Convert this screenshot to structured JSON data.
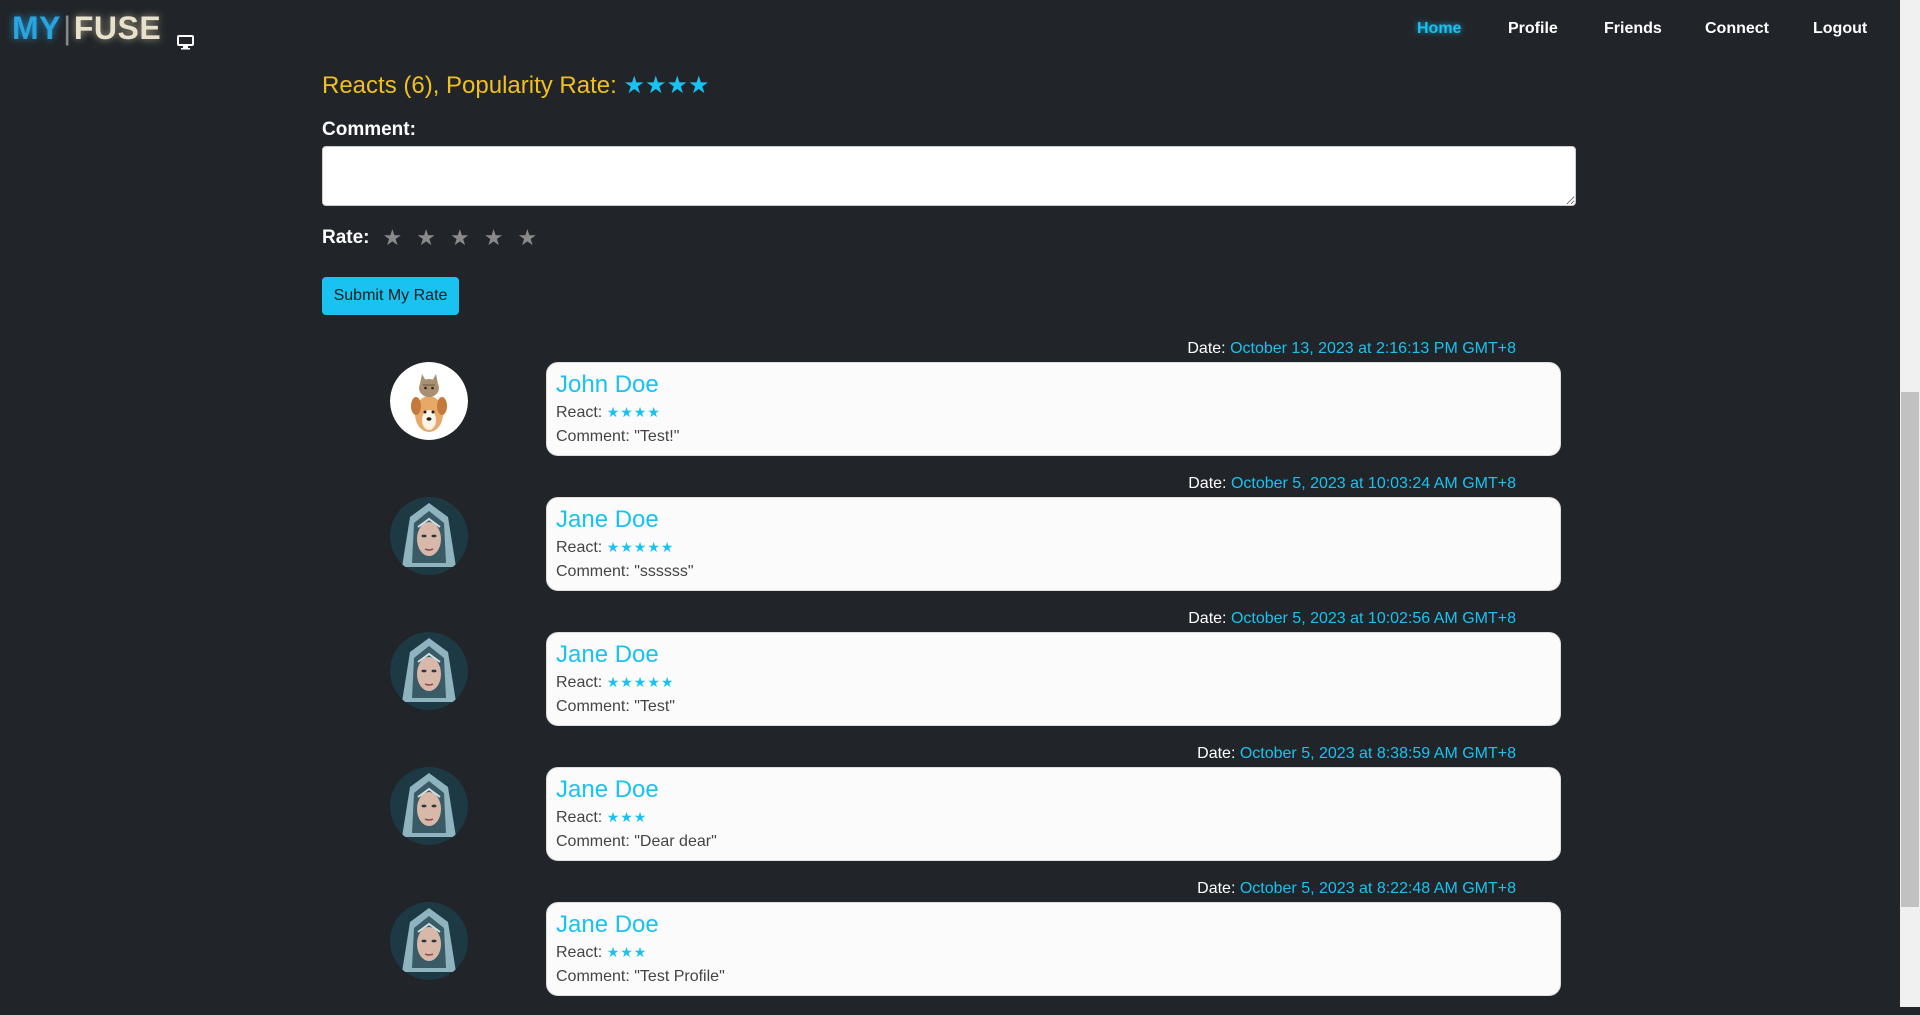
{
  "brand": {
    "my": "MY",
    "sep": "|",
    "fuse": "FUSE",
    "icon": "monitor-icon"
  },
  "nav": [
    {
      "label": "Home",
      "active": true
    },
    {
      "label": "Profile",
      "active": false
    },
    {
      "label": "Friends",
      "active": false
    },
    {
      "label": "Connect",
      "active": false
    },
    {
      "label": "Logout",
      "active": false
    }
  ],
  "summary": {
    "text": "Reacts (6),  Popularity Rate:",
    "stars": "★★★★"
  },
  "comment": {
    "label": "Comment:",
    "value": "",
    "placeholder": ""
  },
  "rate": {
    "label": "Rate:",
    "stars": [
      "★",
      "★",
      "★",
      "★",
      "★"
    ],
    "selected": 0
  },
  "submit_label": "Submit My Rate",
  "reviews": [
    {
      "date_label": "Date:",
      "date": "October 13, 2023 at 2:16:13 PM GMT+8",
      "name": "John Doe",
      "react_label": "React:",
      "stars": "★★★★",
      "comment": "Comment: \"Test!\"",
      "avatar": "dog-cat-avatar"
    },
    {
      "date_label": "Date:",
      "date": "October 5, 2023 at 10:03:24 AM GMT+8",
      "name": "Jane Doe",
      "react_label": "React:",
      "stars": "★★★★★",
      "comment": "Comment: \"ssssss\"",
      "avatar": "warrior-woman-avatar"
    },
    {
      "date_label": "Date:",
      "date": "October 5, 2023 at 10:02:56 AM GMT+8",
      "name": "Jane Doe",
      "react_label": "React:",
      "stars": "★★★★★",
      "comment": "Comment: \"Test\"",
      "avatar": "warrior-woman-avatar"
    },
    {
      "date_label": "Date:",
      "date": "October 5, 2023 at 8:38:59 AM GMT+8",
      "name": "Jane Doe",
      "react_label": "React:",
      "stars": "★★★",
      "comment": "Comment: \"Dear dear\"",
      "avatar": "warrior-woman-avatar"
    },
    {
      "date_label": "Date:",
      "date": "October 5, 2023 at 8:22:48 AM GMT+8",
      "name": "Jane Doe",
      "react_label": "React:",
      "stars": "★★★",
      "comment": "Comment: \"Test Profile\"",
      "avatar": "warrior-woman-avatar"
    }
  ],
  "colors": {
    "background": "#212529",
    "accent": "#19c2f0",
    "gold": "#f0c020"
  }
}
